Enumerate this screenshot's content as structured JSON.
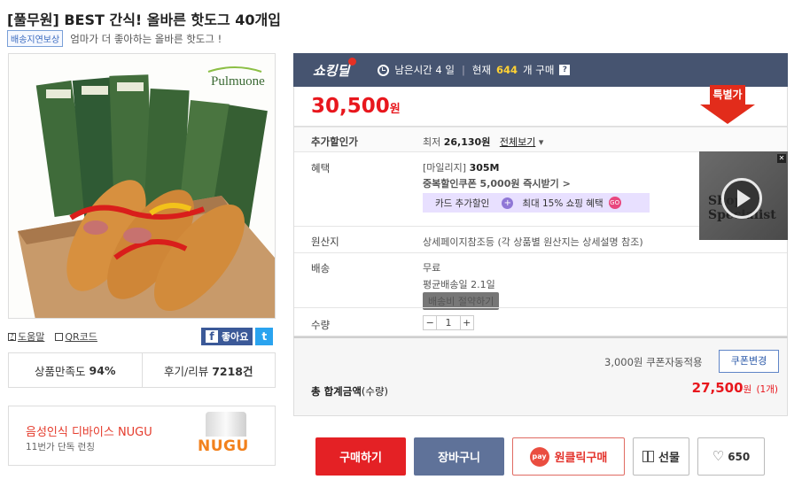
{
  "product": {
    "title": "[풀무원] BEST 간식! 올바른 핫도그 40개입",
    "badge": "배송지연보상",
    "subtitle": "엄마가 더 좋아하는 올바른 핫도그 !",
    "image_brand": "Pulmuone"
  },
  "helpers": {
    "help": "도움말",
    "qr": "QR코드",
    "like": "좋아요"
  },
  "stats": {
    "satisfaction_label": "상품만족도",
    "satisfaction_value": "94%",
    "review_label": "후기/리뷰",
    "review_value": "7218건"
  },
  "ad": {
    "title": "음성인식 디바이스 NUGU",
    "subtitle": "11번가 단독 런칭",
    "logo": "NUGU"
  },
  "shocking": {
    "brand": "쇼킹딜",
    "time_label": "남은시간 4 일",
    "current_prefix": "현재",
    "current_count": "644",
    "current_suffix": "개 구매",
    "help": "?"
  },
  "price": {
    "value": "30,500",
    "unit": "원",
    "special_label": "특별가"
  },
  "rows": {
    "extra_label": "추가할인가",
    "extra_min": "최저",
    "extra_value": "26,130원",
    "extra_view": "전체보기",
    "benefit_label": "혜택",
    "mileage": "[마일리지]",
    "mileage_value": "305M",
    "coupon_text": "중복할인쿠폰 5,000원 즉시받기 >",
    "card_discount": "카드 추가할인",
    "shopping_benefit": "최대 15% 쇼핑 혜택",
    "go": "GO",
    "origin_label": "원산지",
    "origin_value": "상세페이지참조등 (각 상품별 원산지는 상세설명 참조)",
    "ship_label": "배송",
    "ship_free": "무료",
    "ship_avg": "평균배송일 2.1일",
    "ship_save": "배송비 절약하기",
    "qty_label": "수량",
    "qty_minus": "−",
    "qty_value": "1",
    "qty_plus": "+"
  },
  "video": {
    "watermark": "Shop Specialist"
  },
  "total": {
    "coupon_auto": "3,000원 쿠폰자동적용",
    "coupon_change": "쿠폰변경",
    "label": "총 합계금액",
    "label_suffix": "(수량)",
    "value": "27,500",
    "unit": "원",
    "count": "(1개)"
  },
  "actions": {
    "buy": "구매하기",
    "cart": "장바구니",
    "pay_icon": "pay",
    "oneclick": "원클릭구매",
    "gift": "선물",
    "like_count": "650"
  }
}
